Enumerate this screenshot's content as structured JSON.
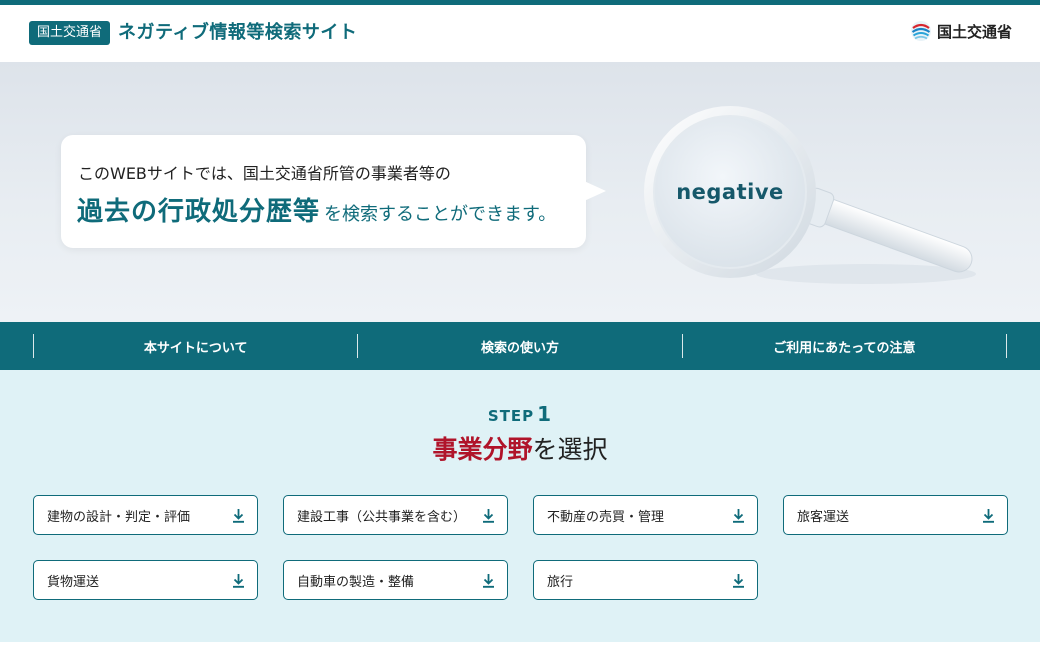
{
  "header": {
    "badge": "国土交通省",
    "title": "ネガティブ情報等検索サイト",
    "ministry": "国土交通省"
  },
  "hero": {
    "line1": "このWEBサイトでは、国土交通省所管の事業者等の",
    "line2_strong": "過去の行政処分歴等",
    "line2_rest": "を検索することができます。",
    "magnifier_word": "negative"
  },
  "nav": {
    "items": [
      {
        "label": "本サイトについて"
      },
      {
        "label": "検索の使い方"
      },
      {
        "label": "ご利用にあたっての注意"
      }
    ]
  },
  "step": {
    "label": "STEP",
    "number": "1",
    "title_accent": "事業分野",
    "title_rest": "を選択"
  },
  "fields": [
    {
      "label": "建物の設計・判定・評価"
    },
    {
      "label": "建設工事（公共事業を含む）"
    },
    {
      "label": "不動産の売買・管理"
    },
    {
      "label": "旅客運送"
    },
    {
      "label": "貨物運送"
    },
    {
      "label": "自動車の製造・整備"
    },
    {
      "label": "旅行"
    }
  ],
  "colors": {
    "brand": "#0f6b7a",
    "accent": "#b0142a",
    "section_bg": "#dff2f6"
  },
  "icons": {
    "field_button": "download-arrow-icon",
    "ministry": "ministry-logo-icon",
    "hero": "magnifying-glass-icon"
  }
}
